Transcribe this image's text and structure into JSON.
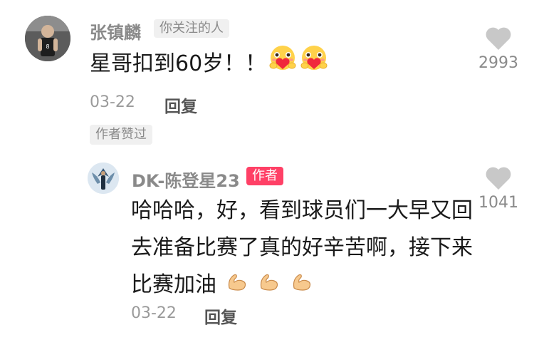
{
  "comment": {
    "username": "张镇麟",
    "follow_tag": "你关注的人",
    "text": "星哥扣到60岁！！",
    "date": "03-22",
    "reply_label": "回复",
    "like_count": "2993",
    "author_liked": "作者赞过"
  },
  "reply": {
    "username": "DK-陈登星23",
    "author_tag": "作者",
    "text": "哈哈哈，好，看到球员们一大早又回去准备比赛了真的好辛苦啊，接下来比赛加油",
    "date": "03-22",
    "reply_label": "回复",
    "like_count": "1041"
  },
  "colors": {
    "author_tag_bg": "#ff4066",
    "heart": "#c8c8c8"
  }
}
